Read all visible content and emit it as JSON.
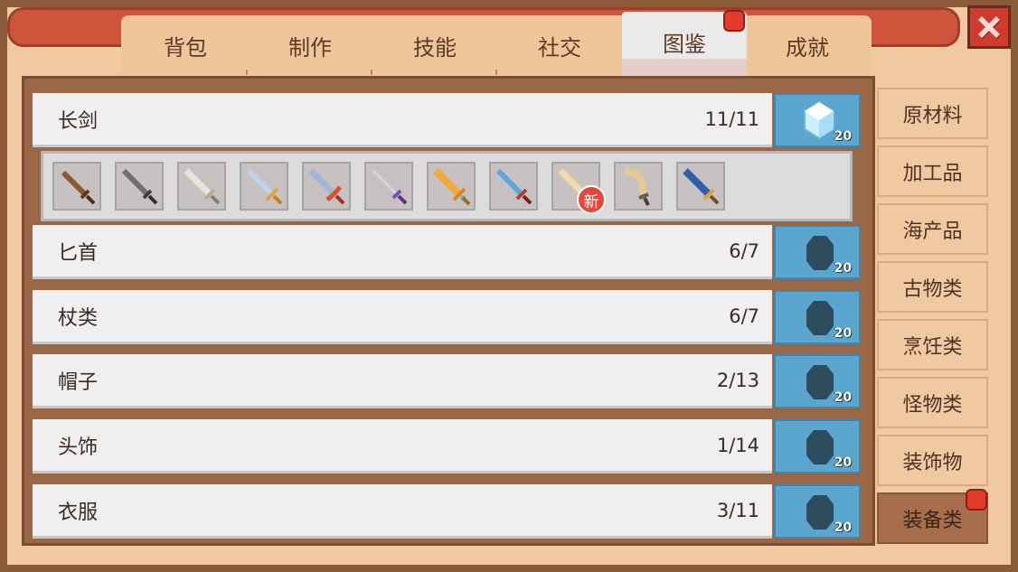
{
  "tabs": [
    {
      "label": "背包",
      "active": false
    },
    {
      "label": "制作",
      "active": false
    },
    {
      "label": "技能",
      "active": false
    },
    {
      "label": "社交",
      "active": false
    },
    {
      "label": "图鉴",
      "active": true
    },
    {
      "label": "成就",
      "active": false
    }
  ],
  "categories": [
    {
      "name": "长剑",
      "count": "11/11",
      "reward": "20",
      "unlocked": true,
      "expanded": true
    },
    {
      "name": "匕首",
      "count": "6/7",
      "reward": "20",
      "unlocked": false
    },
    {
      "name": "杖类",
      "count": "6/7",
      "reward": "20",
      "unlocked": false
    },
    {
      "name": "帽子",
      "count": "2/13",
      "reward": "20",
      "unlocked": false
    },
    {
      "name": "头饰",
      "count": "1/14",
      "reward": "20",
      "unlocked": false
    },
    {
      "name": "衣服",
      "count": "3/11",
      "reward": "20",
      "unlocked": false
    }
  ],
  "new_label": "新",
  "sword_icons": [
    "bronze-sword-icon",
    "iron-sword-icon",
    "bone-sword-icon",
    "silver-gold-sword-icon",
    "red-guard-sword-icon",
    "purple-rapier-icon",
    "golden-sword-icon",
    "blue-steel-sword-icon",
    "ivory-sword-icon",
    "scimitar-icon",
    "blue-broadsword-icon"
  ],
  "sidebar": [
    {
      "label": "原材料",
      "active": false
    },
    {
      "label": "加工品",
      "active": false
    },
    {
      "label": "海产品",
      "active": false
    },
    {
      "label": "古物类",
      "active": false
    },
    {
      "label": "烹饪类",
      "active": false
    },
    {
      "label": "怪物类",
      "active": false
    },
    {
      "label": "装饰物",
      "active": false
    },
    {
      "label": "装备类",
      "active": true
    }
  ],
  "colors": {
    "frame": "#8b5a36",
    "tab_bg": "#efc59a",
    "reward_badge": "#5aa6cf",
    "notify": "#e23b2c"
  }
}
